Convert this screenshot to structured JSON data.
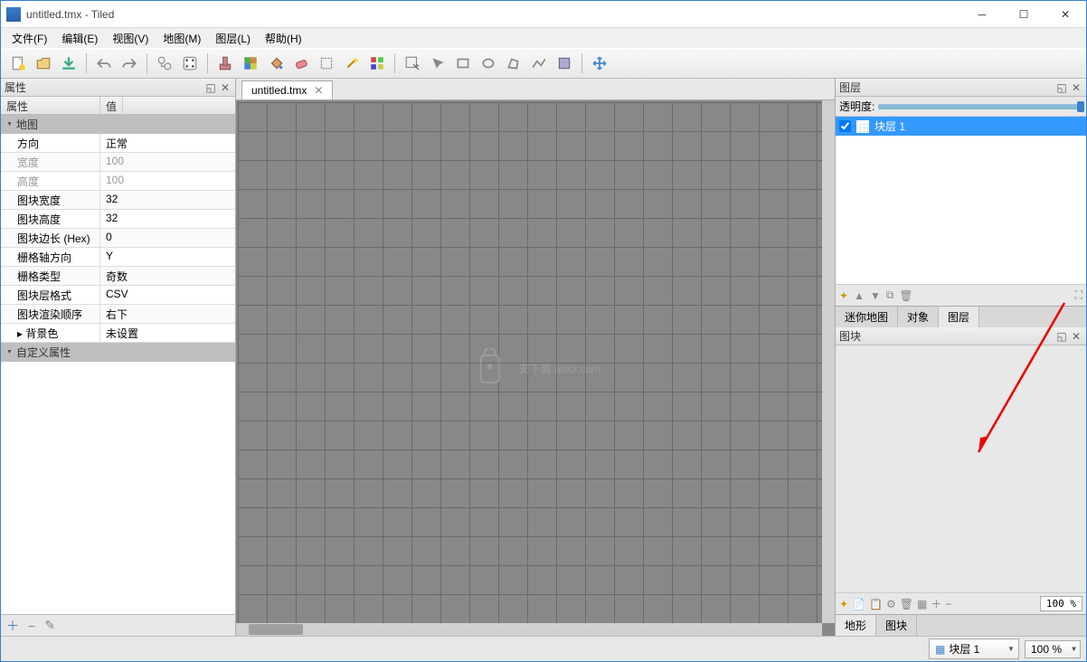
{
  "window": {
    "title": "untitled.tmx - Tiled"
  },
  "menu": {
    "file": "文件(F)",
    "edit": "编辑(E)",
    "view": "视图(V)",
    "map": "地图(M)",
    "layer": "图层(L)",
    "help": "帮助(H)"
  },
  "properties_panel": {
    "title": "属性",
    "col_name": "属性",
    "col_val": "值",
    "group_map": "地图",
    "group_custom": "自定义属性",
    "rows": {
      "orientation": {
        "name": "方向",
        "value": "正常"
      },
      "width": {
        "name": "宽度",
        "value": "100"
      },
      "height": {
        "name": "高度",
        "value": "100"
      },
      "tile_width": {
        "name": "图块宽度",
        "value": "32"
      },
      "tile_height": {
        "name": "图块高度",
        "value": "32"
      },
      "hex_side": {
        "name": "图块边长 (Hex)",
        "value": "0"
      },
      "stagger_axis": {
        "name": "栅格轴方向",
        "value": "Y"
      },
      "stagger_index": {
        "name": "栅格类型",
        "value": "奇数"
      },
      "layer_format": {
        "name": "图块层格式",
        "value": "CSV"
      },
      "render_order": {
        "name": "图块渲染顺序",
        "value": "右下"
      },
      "bg_color": {
        "name": "背景色",
        "value": "未设置"
      }
    }
  },
  "document": {
    "tab_name": "untitled.tmx"
  },
  "layers_panel": {
    "title": "图层",
    "opacity_label": "透明度:",
    "items": [
      {
        "name": "块层 1",
        "visible": true
      }
    ],
    "tabs": {
      "minimap": "迷你地图",
      "objects": "对象",
      "layers": "图层"
    }
  },
  "tileset_panel": {
    "title": "图块",
    "zoom": "100 %",
    "tabs": {
      "terrain": "地形",
      "tiles": "图块"
    }
  },
  "bottom": {
    "layer_combo": "块层 1",
    "zoom": "100 %"
  },
  "watermark": "安下载 anxz.com"
}
